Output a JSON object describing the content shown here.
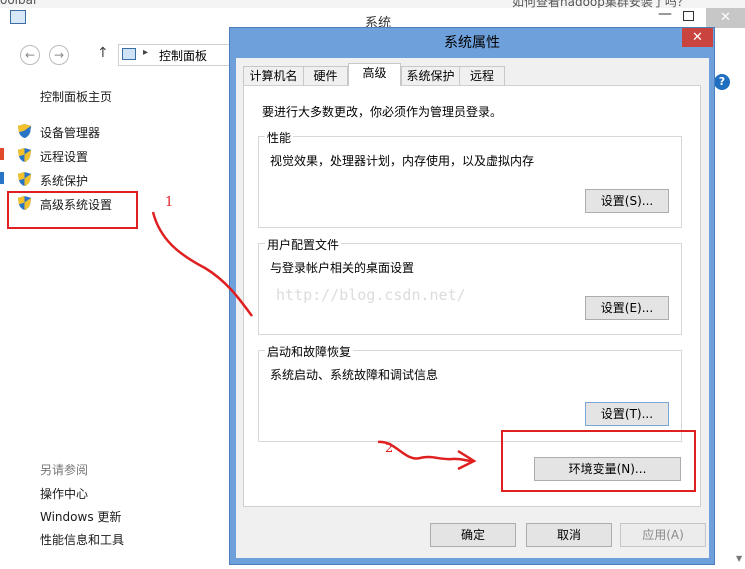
{
  "top_fragments": {
    "left": "oolbar",
    "right": "如何查看hadoop集群安装了吗？"
  },
  "window": {
    "title": "系统",
    "min": "—",
    "close": "✕",
    "help": "?"
  },
  "nav": {
    "back": "←",
    "forward": "→",
    "up": "↑",
    "separator": "▸",
    "breadcrumb": "控制面板"
  },
  "sidebar": {
    "home": "控制面板主页",
    "items": [
      {
        "label": "设备管理器",
        "icon": "uac-shield-icon"
      },
      {
        "label": "远程设置",
        "icon": "uac-shield-icon"
      },
      {
        "label": "系统保护",
        "icon": "uac-shield-icon"
      },
      {
        "label": "高级系统设置",
        "icon": "uac-shield-icon"
      }
    ],
    "see_also": "另请参阅",
    "links": [
      "操作中心",
      "Windows 更新",
      "性能信息和工具"
    ]
  },
  "annotations": {
    "step1": "1",
    "step2": "2",
    "color": "#e02020"
  },
  "watermark": "http://blog.csdn.net/",
  "dialog": {
    "title": "系统属性",
    "close": "✕",
    "tabs": [
      "计算机名",
      "硬件",
      "高级",
      "系统保护",
      "远程"
    ],
    "active_tab": "高级",
    "admin_note": "要进行大多数更改，你必须作为管理员登录。",
    "groups": [
      {
        "title": "性能",
        "description": "视觉效果，处理器计划，内存使用，以及虚拟内存",
        "button": "设置(S)..."
      },
      {
        "title": "用户配置文件",
        "description": "与登录帐户相关的桌面设置",
        "button": "设置(E)..."
      },
      {
        "title": "启动和故障恢复",
        "description": "系统启动、系统故障和调试信息",
        "button": "设置(T)..."
      }
    ],
    "env_button": "环境变量(N)...",
    "ok": "确定",
    "cancel": "取消",
    "apply": "应用(A)"
  }
}
